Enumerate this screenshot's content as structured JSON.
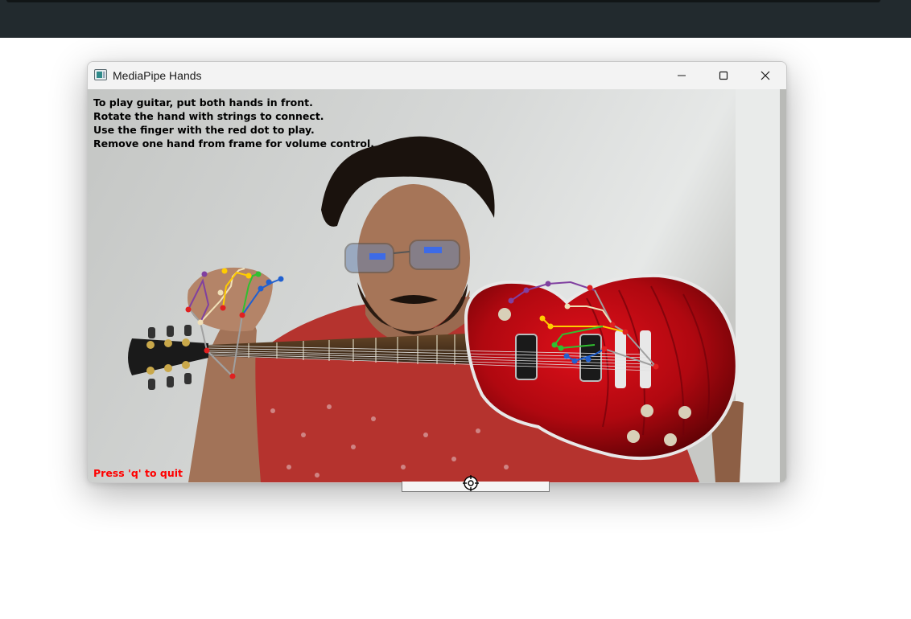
{
  "window": {
    "title": "MediaPipe Hands",
    "icon": "opencv-window-icon",
    "controls": [
      "minimize-icon",
      "maximize-icon",
      "close-icon"
    ]
  },
  "overlay": {
    "instructions": [
      "To play guitar, put both hands in front.",
      "Rotate the hand with strings to connect.",
      "Use the finger with the red dot to play.",
      "Remove one hand from frame for volume control."
    ],
    "quit_hint": "Press 'q' to quit",
    "quit_color": "#ff0000"
  },
  "landmark_colors": {
    "palm": "#a0a0a0",
    "thumb": "#f0e0b8",
    "index": "#8040a0",
    "middle": "#ffcc00",
    "ring": "#30c030",
    "pinky": "#2060d0",
    "joint": "#e02020"
  },
  "desktop": {
    "topbar_color": "#222a2e"
  }
}
